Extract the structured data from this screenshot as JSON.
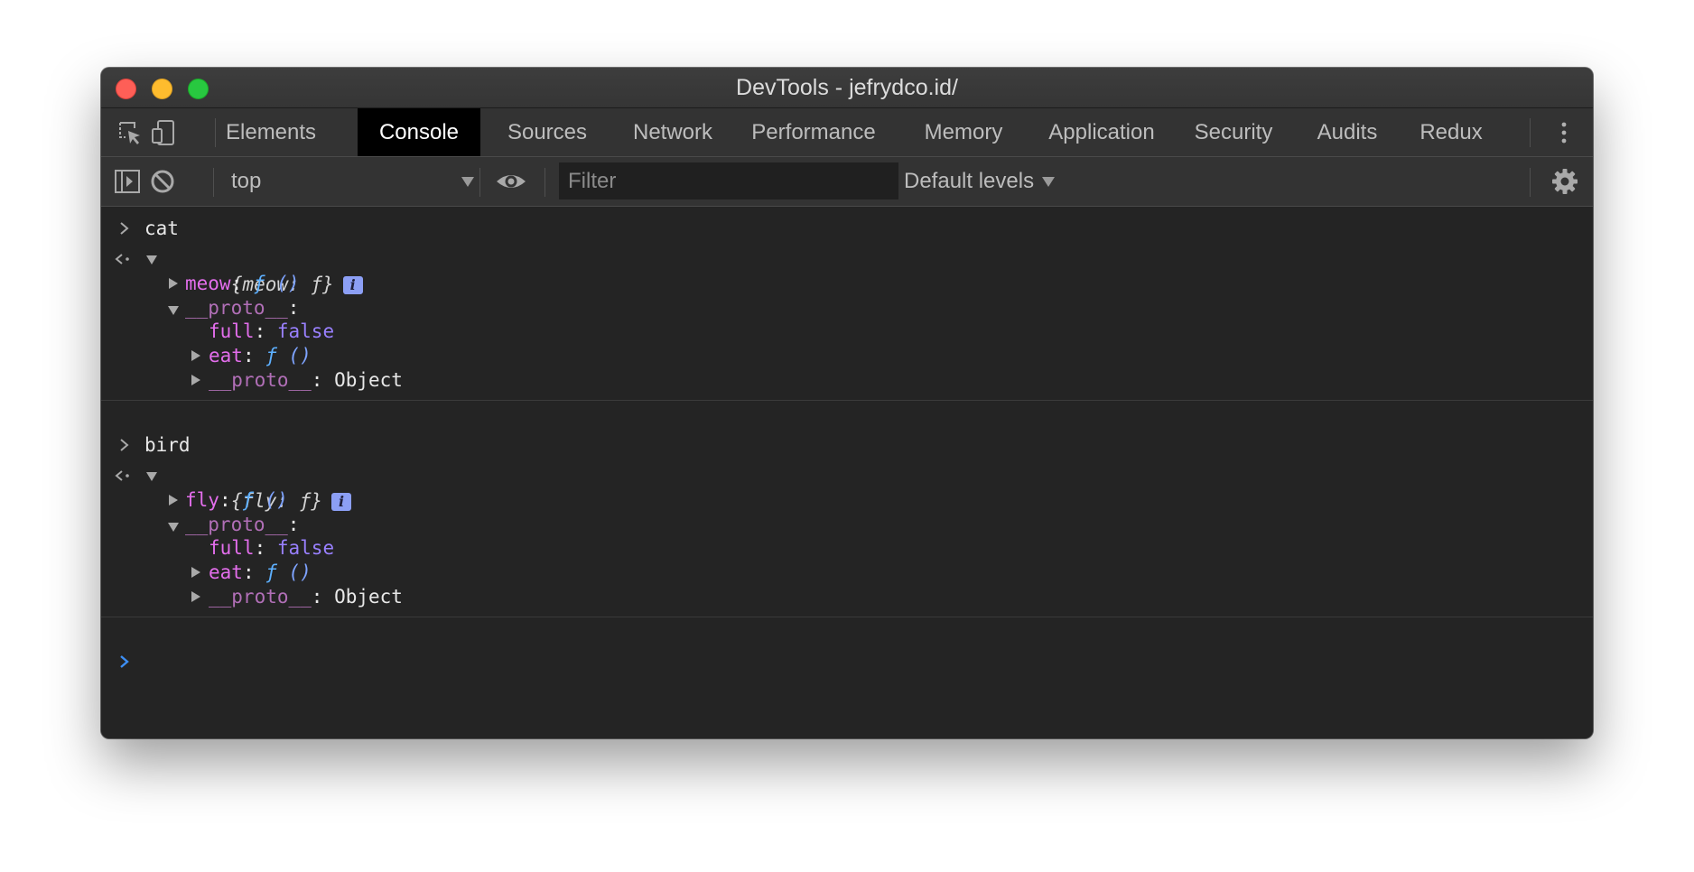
{
  "window": {
    "title": "DevTools - jefrydco.id/"
  },
  "tabs": [
    {
      "label": "Elements"
    },
    {
      "label": "Console",
      "active": true
    },
    {
      "label": "Sources"
    },
    {
      "label": "Network"
    },
    {
      "label": "Performance"
    },
    {
      "label": "Memory"
    },
    {
      "label": "Application"
    },
    {
      "label": "Security"
    },
    {
      "label": "Audits"
    },
    {
      "label": "Redux"
    }
  ],
  "toolbar": {
    "context": "top",
    "filter_placeholder": "Filter",
    "levels": "Default levels"
  },
  "console": {
    "entries": [
      {
        "input": "cat",
        "preview": "{meow: ƒ}",
        "info_badge": "i",
        "own_prop": {
          "key": "meow",
          "sep": ": ",
          "fn": "ƒ",
          "params": " ()"
        },
        "proto_label": "__proto__",
        "proto_colon": ":",
        "proto_full": {
          "key": "full",
          "sep": ": ",
          "value": "false"
        },
        "proto_eat": {
          "key": "eat",
          "sep": ": ",
          "fn": "ƒ",
          "params": " ()"
        },
        "proto_proto": {
          "key": "__proto__",
          "sep": ": ",
          "value": "Object"
        }
      },
      {
        "input": "bird",
        "preview": "{fly: ƒ}",
        "info_badge": "i",
        "own_prop": {
          "key": "fly",
          "sep": ": ",
          "fn": "ƒ",
          "params": " ()"
        },
        "proto_label": "__proto__",
        "proto_colon": ":",
        "proto_full": {
          "key": "full",
          "sep": ": ",
          "value": "false"
        },
        "proto_eat": {
          "key": "eat",
          "sep": ": ",
          "fn": "ƒ",
          "params": " ()"
        },
        "proto_proto": {
          "key": "__proto__",
          "sep": ": ",
          "value": "Object"
        }
      }
    ]
  },
  "colors": {
    "own_key": "#e36eec",
    "proto_key": "#b16fb7",
    "boolean": "#9980ff",
    "function_keyword": "#5db0ff",
    "prompt_active": "#3d8ff5"
  }
}
